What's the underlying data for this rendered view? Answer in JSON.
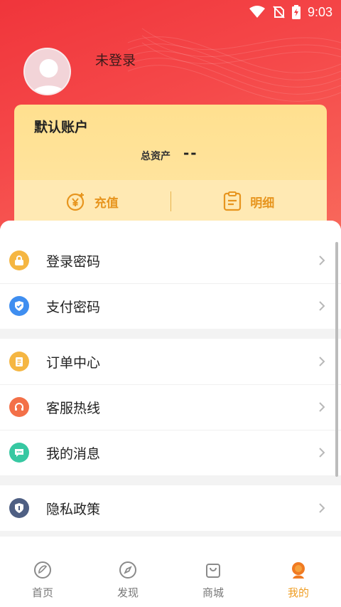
{
  "status_bar": {
    "time": "9:03"
  },
  "profile": {
    "username": "未登录"
  },
  "account": {
    "title": "默认账户",
    "asset_label": "总资产",
    "asset_value": "--",
    "recharge_label": "充值",
    "detail_label": "明细"
  },
  "menu": {
    "group1": [
      {
        "label": "登录密码",
        "icon": "lock-icon",
        "color": "#f5b642"
      },
      {
        "label": "支付密码",
        "icon": "shield-check-icon",
        "color": "#3f8ef0"
      }
    ],
    "group2": [
      {
        "label": "订单中心",
        "icon": "clipboard-icon",
        "color": "#f5b642"
      },
      {
        "label": "客服热线",
        "icon": "headset-icon",
        "color": "#f37048"
      },
      {
        "label": "我的消息",
        "icon": "chat-icon",
        "color": "#37c8a2"
      }
    ],
    "group3": [
      {
        "label": "隐私政策",
        "icon": "privacy-shield-icon",
        "color": "#4e5f83"
      }
    ]
  },
  "tabs": [
    {
      "label": "首页",
      "icon": "home-icon"
    },
    {
      "label": "发现",
      "icon": "compass-icon"
    },
    {
      "label": "商城",
      "icon": "bag-icon"
    },
    {
      "label": "我的",
      "icon": "profile-icon",
      "active": true
    }
  ],
  "colors": {
    "header_red": "#f0353b",
    "accent_orange": "#ef9d22",
    "card_yellow": "#ffe08f"
  }
}
